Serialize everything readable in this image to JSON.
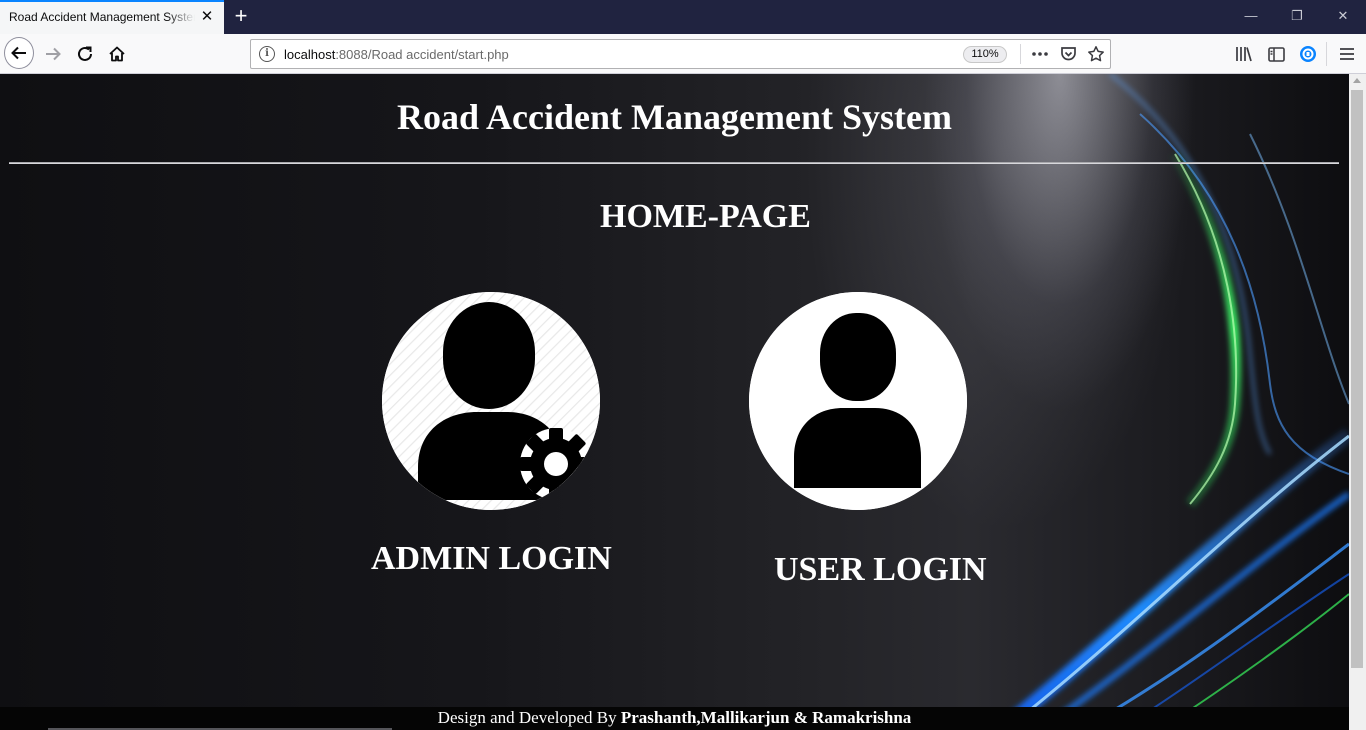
{
  "browser": {
    "tab_title": "Road Accident Management System",
    "tab_close": "✕",
    "new_tab": "+",
    "url_host": "localhost",
    "url_rest": ":8088/Road accident/start.php",
    "zoom": "110%",
    "window_controls": {
      "minimize": "—",
      "restore": "❐",
      "close": "✕"
    }
  },
  "page": {
    "title": "Road Accident Management System",
    "heading": "HOME-PAGE",
    "admin": {
      "label": "ADMIN LOGIN",
      "icon": "admin-user-gear-icon"
    },
    "user": {
      "label": "USER LOGIN",
      "icon": "user-icon"
    },
    "footer": {
      "prefix": "Design and Developed By ",
      "authors": "Prashanth,Mallikarjun & Ramakrishna"
    }
  },
  "colors": {
    "background": "#1f1f22",
    "text": "#ffffff",
    "wave_green": "#3cff6a",
    "wave_blue": "#1e8cff"
  }
}
